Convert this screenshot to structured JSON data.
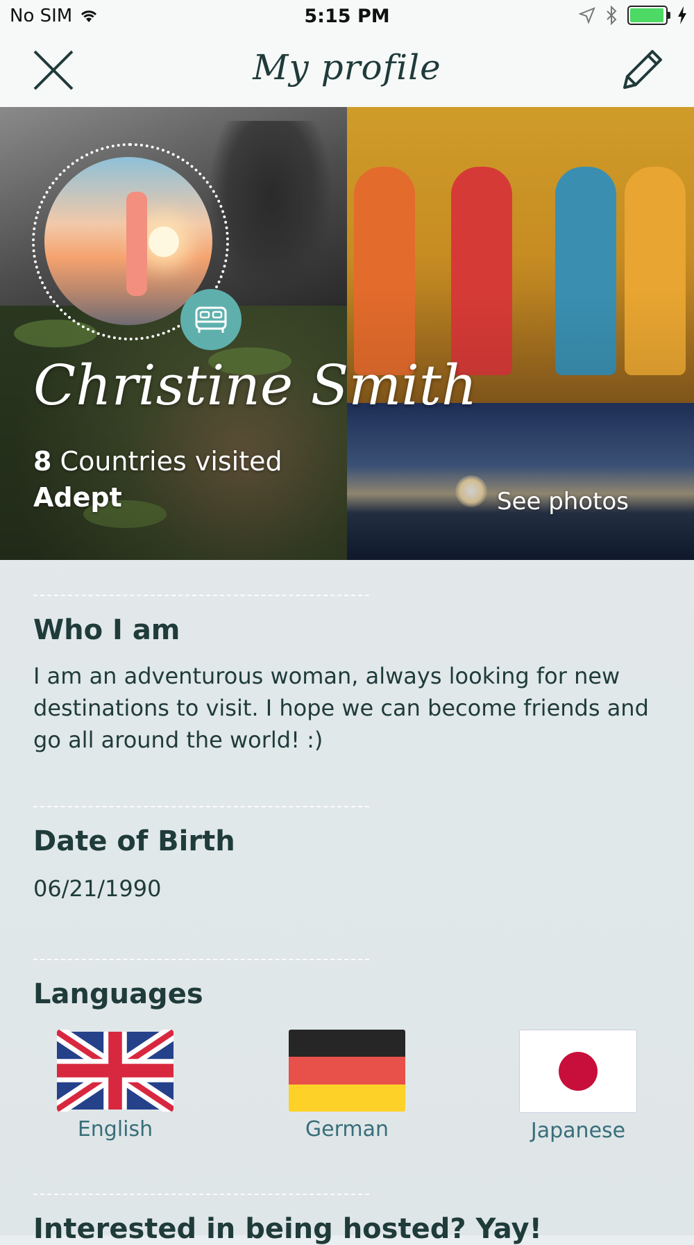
{
  "status_bar": {
    "carrier": "No SIM",
    "time": "5:15 PM"
  },
  "nav": {
    "title": "My profile"
  },
  "profile": {
    "name": "Christine Smith",
    "countries_count": "8",
    "countries_label": "Countries visited",
    "level": "Adept",
    "see_photos": "See photos"
  },
  "sections": {
    "about_title": "Who I am",
    "about_text": "I am an adventurous woman, always looking for new destinations to visit. I hope we can become friends and go all around the world! :)",
    "dob_title": "Date of Birth",
    "dob_value": "06/21/1990",
    "languages_title": "Languages",
    "hosted_title": "Interested in being hosted? Yay!"
  },
  "languages": [
    {
      "label": "English",
      "flag": "uk-flag-icon"
    },
    {
      "label": "German",
      "flag": "germany-flag-icon"
    },
    {
      "label": "Japanese",
      "flag": "japan-flag-icon"
    }
  ],
  "colors": {
    "accent_teal": "#5fb0ad",
    "text_dark": "#1f3b3a",
    "language_label": "#386e7a",
    "battery_green": "#4cd964"
  }
}
